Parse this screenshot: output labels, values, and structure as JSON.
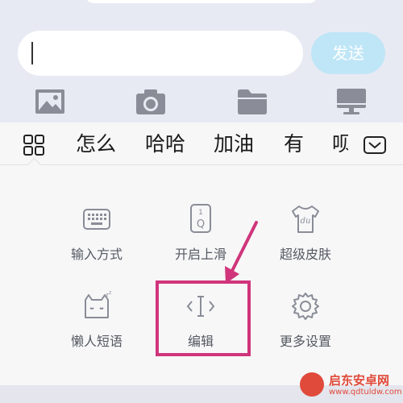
{
  "composer": {
    "message_value": "",
    "send_label": "发送"
  },
  "attachments": {
    "items": [
      {
        "icon": "image-icon"
      },
      {
        "icon": "camera-icon"
      },
      {
        "icon": "folder-icon"
      },
      {
        "icon": "desktop-icon"
      }
    ]
  },
  "candidates": {
    "items": [
      "怎么",
      "哈哈",
      "加油",
      "有",
      "呗"
    ]
  },
  "toolbox": {
    "items": [
      {
        "label": "输入方式",
        "icon": "keyboard-icon"
      },
      {
        "label": "开启上滑",
        "icon": "swipe-up-key-icon"
      },
      {
        "label": "超级皮肤",
        "icon": "skin-shirt-icon"
      },
      {
        "label": "懒人短语",
        "icon": "lazy-cat-icon"
      },
      {
        "label": "编辑",
        "icon": "text-cursor-edit-icon"
      },
      {
        "label": "更多设置",
        "icon": "gear-icon"
      }
    ]
  },
  "watermark": {
    "title": "启东安卓网",
    "url": "www.qdtuldw.com"
  },
  "colors": {
    "highlight": "#d0357b",
    "send_button": "#bfe6f7",
    "icon_gray": "#8a8d97",
    "watermark": "#e04a3a"
  }
}
